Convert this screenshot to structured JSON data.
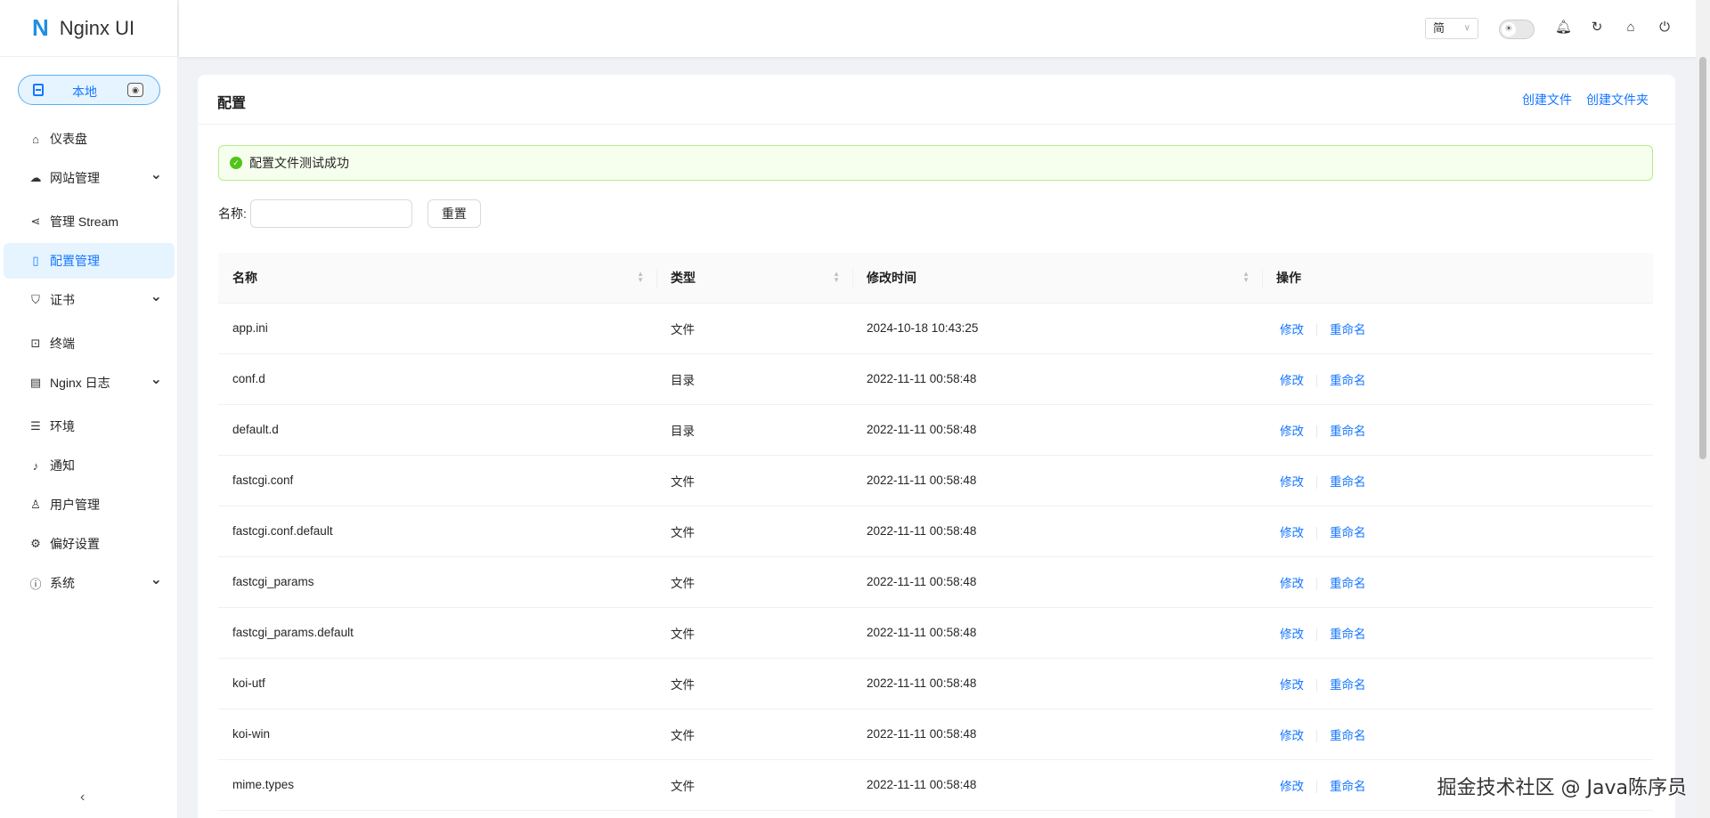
{
  "app": {
    "logo_mark": "N",
    "title": "Nginx UI"
  },
  "env": {
    "label": "本地",
    "btn_icon": "◉"
  },
  "sidebar": {
    "items": [
      {
        "label": "仪表盘",
        "icon": "⌂",
        "expand": false,
        "active": false
      },
      {
        "label": "网站管理",
        "icon": "☁",
        "expand": true,
        "active": false
      },
      {
        "label": "管理 Stream",
        "icon": "⋖",
        "expand": false,
        "active": false
      },
      {
        "label": "配置管理",
        "icon": "▯",
        "expand": false,
        "active": true
      },
      {
        "label": "证书",
        "icon": "⛉",
        "expand": true,
        "active": false
      },
      {
        "label": "终端",
        "icon": "⊡",
        "expand": false,
        "active": false
      },
      {
        "label": "Nginx 日志",
        "icon": "▤",
        "expand": true,
        "active": false
      },
      {
        "label": "环境",
        "icon": "☰",
        "expand": false,
        "active": false
      },
      {
        "label": "通知",
        "icon": "♪",
        "expand": false,
        "active": false
      },
      {
        "label": "用户管理",
        "icon": "♙",
        "expand": false,
        "active": false
      },
      {
        "label": "偏好设置",
        "icon": "⚙",
        "expand": false,
        "active": false
      },
      {
        "label": "系统",
        "icon": "ⓘ",
        "expand": true,
        "active": false
      }
    ],
    "collapse_icon": "‹"
  },
  "header": {
    "lang": "简",
    "icons": [
      "bell-icon",
      "reload-icon",
      "home-icon",
      "logout-icon"
    ]
  },
  "card": {
    "title": "配置",
    "create_file": "创建文件",
    "create_folder": "创建文件夹"
  },
  "alert": {
    "message": "配置文件测试成功"
  },
  "search": {
    "label": "名称:",
    "value": "",
    "reset": "重置"
  },
  "table": {
    "headers": [
      "名称",
      "类型",
      "修改时间",
      "操作"
    ],
    "rows": [
      {
        "name": "app.ini",
        "type": "文件",
        "time": "2024-10-18 10:43:25"
      },
      {
        "name": "conf.d",
        "type": "目录",
        "time": "2022-11-11 00:58:48"
      },
      {
        "name": "default.d",
        "type": "目录",
        "time": "2022-11-11 00:58:48"
      },
      {
        "name": "fastcgi.conf",
        "type": "文件",
        "time": "2022-11-11 00:58:48"
      },
      {
        "name": "fastcgi.conf.default",
        "type": "文件",
        "time": "2022-11-11 00:58:48"
      },
      {
        "name": "fastcgi_params",
        "type": "文件",
        "time": "2022-11-11 00:58:48"
      },
      {
        "name": "fastcgi_params.default",
        "type": "文件",
        "time": "2022-11-11 00:58:48"
      },
      {
        "name": "koi-utf",
        "type": "文件",
        "time": "2022-11-11 00:58:48"
      },
      {
        "name": "koi-win",
        "type": "文件",
        "time": "2022-11-11 00:58:48"
      },
      {
        "name": "mime.types",
        "type": "文件",
        "time": "2022-11-11 00:58:48"
      }
    ],
    "edit_label": "修改",
    "rename_label": "重命名"
  },
  "watermark": "掘金技术社区 @ Java陈序员"
}
